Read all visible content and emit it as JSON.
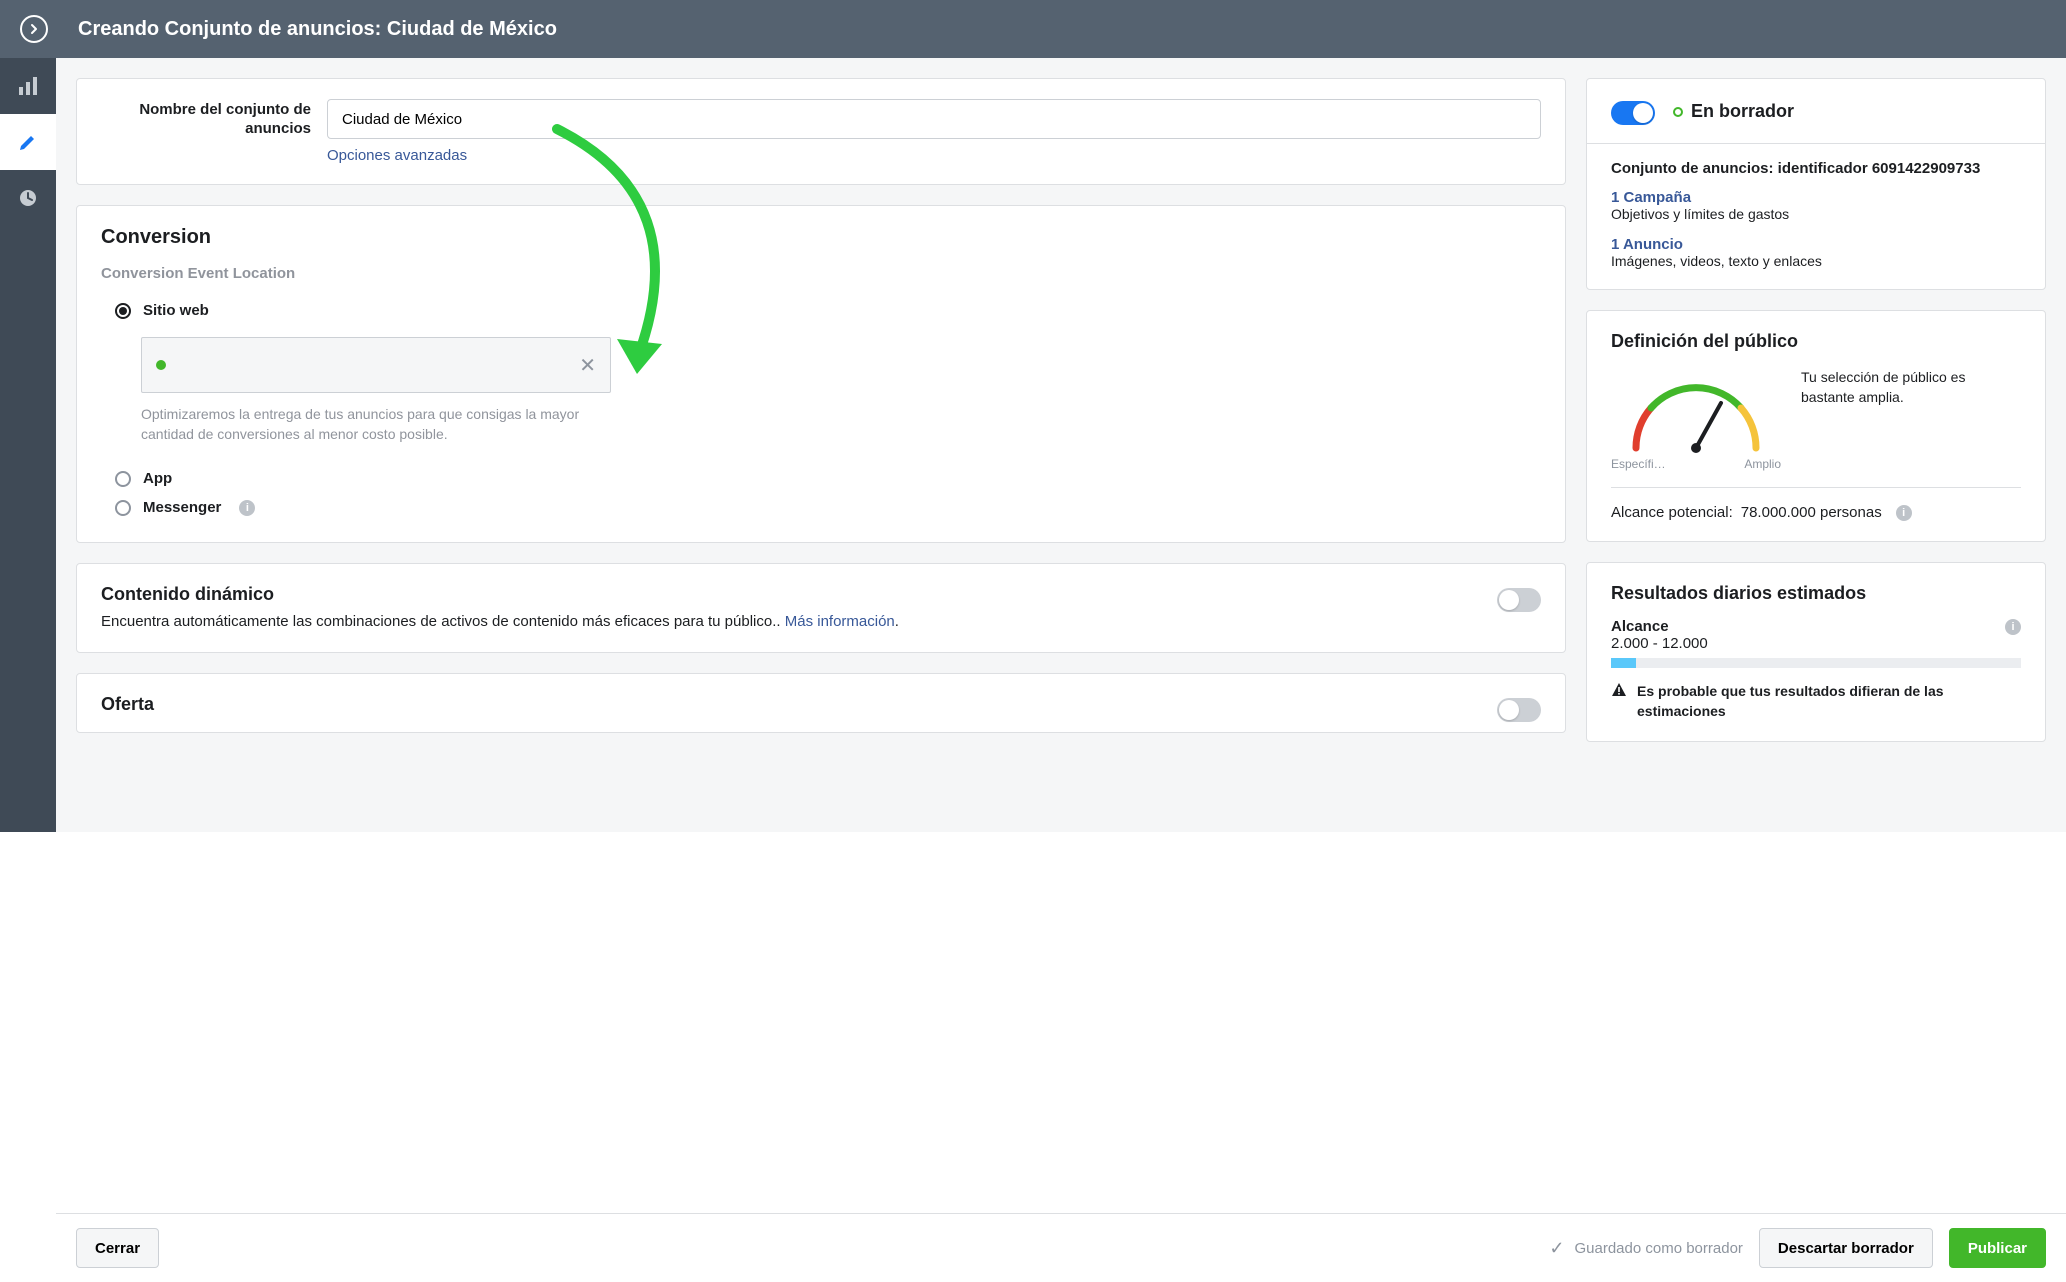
{
  "header": {
    "title": "Creando Conjunto de anuncios: Ciudad de México"
  },
  "adset": {
    "name_label": "Nombre del conjunto de anuncios",
    "name_value": "Ciudad de México",
    "advanced_options": "Opciones avanzadas"
  },
  "conversion": {
    "title": "Conversion",
    "event_location_label": "Conversion Event Location",
    "options": {
      "website": "Sitio web",
      "app": "App",
      "messenger": "Messenger"
    },
    "helper": "Optimizaremos la entrega de tus anuncios para que consigas la mayor cantidad de conversiones al menor costo posible."
  },
  "dynamic": {
    "title": "Contenido dinámico",
    "desc_prefix": "Encuentra automáticamente las combinaciones de activos de contenido más eficaces para tu público.. ",
    "more_info": "Más información",
    "dot": "."
  },
  "offer": {
    "title": "Oferta"
  },
  "status_panel": {
    "draft": "En borrador",
    "id_line": "Conjunto de anuncios: identificador 6091422909733",
    "campaign_link": "1 Campaña",
    "campaign_sub": "Objetivos y límites de gastos",
    "ad_link": "1 Anuncio",
    "ad_sub": "Imágenes, videos, texto y enlaces"
  },
  "audience": {
    "title": "Definición del público",
    "specific": "Específi…",
    "broad": "Amplio",
    "message": "Tu selección de público es bastante amplia.",
    "reach_label": "Alcance potencial:",
    "reach_value": "78.000.000 personas"
  },
  "estimates": {
    "title": "Resultados diarios estimados",
    "reach_label": "Alcance",
    "reach_range": "2.000 - 12.000",
    "warning": "Es probable que tus resultados difieran de las estimaciones"
  },
  "footer": {
    "close": "Cerrar",
    "saved": "Guardado como borrador",
    "discard": "Descartar borrador",
    "publish": "Publicar"
  }
}
